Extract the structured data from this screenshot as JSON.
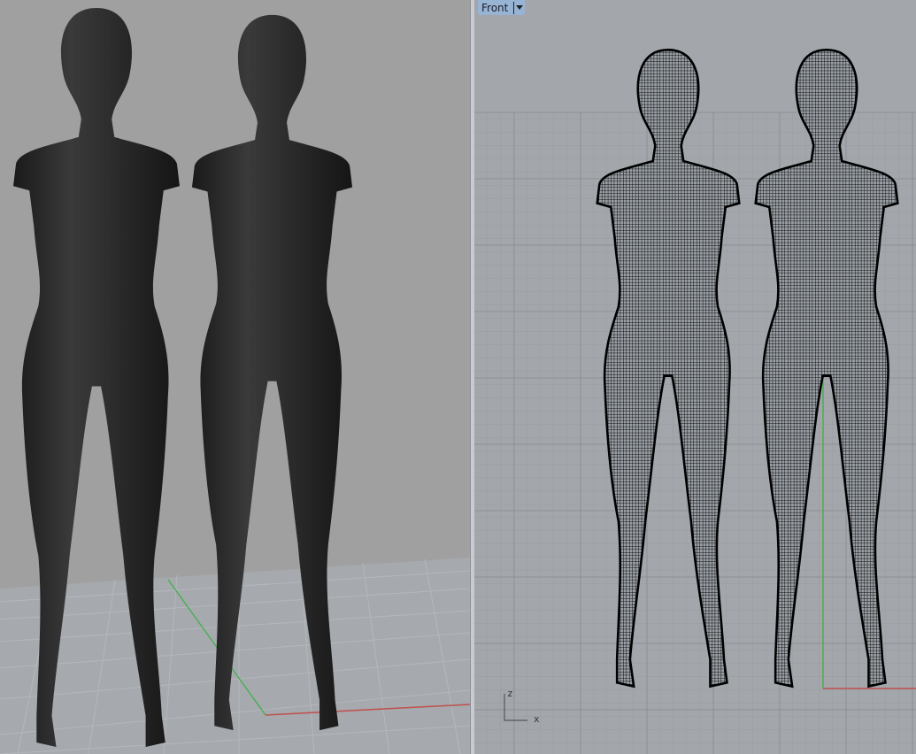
{
  "viewports": {
    "perspective": {
      "background": "#a0a0a0"
    },
    "front": {
      "label": "Front",
      "background": "#a3a7ac"
    }
  },
  "axis_widget": {
    "z_label": "z",
    "x_label": "x"
  },
  "colors": {
    "x_axis": "#c0504d",
    "y_axis": "#4caf50",
    "z_axis": "#3cb043",
    "grid": "#959a9f"
  }
}
